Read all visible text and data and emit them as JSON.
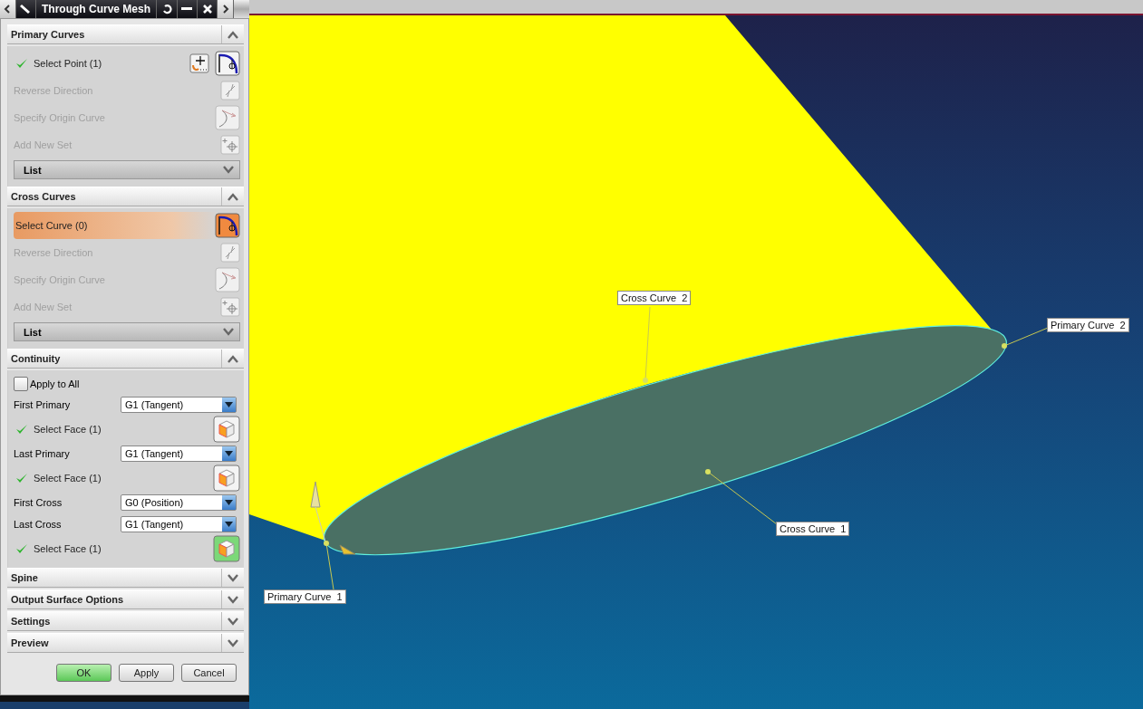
{
  "dialog": {
    "title": "Through Curve Mesh",
    "sections": [
      {
        "title": "Primary Curves",
        "expanded": true,
        "rows": [
          {
            "kind": "curve-select",
            "label": "Select Point (1)",
            "done": true,
            "active": false
          },
          {
            "kind": "reverse",
            "label": "Reverse Direction",
            "disabled": true
          },
          {
            "kind": "origin",
            "label": "Specify Origin Curve",
            "disabled": true
          },
          {
            "kind": "add-set",
            "label": "Add New Set",
            "disabled": true
          },
          {
            "kind": "list",
            "label": "List"
          }
        ]
      },
      {
        "title": "Cross Curves",
        "expanded": true,
        "rows": [
          {
            "kind": "curve-select",
            "label": "Select Curve (0)",
            "done": false,
            "active": true
          },
          {
            "kind": "reverse",
            "label": "Reverse Direction",
            "disabled": true
          },
          {
            "kind": "origin",
            "label": "Specify Origin Curve",
            "disabled": true
          },
          {
            "kind": "add-set",
            "label": "Add New Set",
            "disabled": true
          },
          {
            "kind": "list",
            "label": "List"
          }
        ]
      },
      {
        "title": "Continuity",
        "expanded": true,
        "rows": [
          {
            "kind": "checkbox",
            "label": "Apply to All",
            "checked": false
          },
          {
            "kind": "dropdown",
            "label": "First Primary",
            "value": "G1 (Tangent)"
          },
          {
            "kind": "face-select",
            "label": "Select Face (1)",
            "done": true,
            "active": false
          },
          {
            "kind": "dropdown",
            "label": "Last Primary",
            "value": "G1 (Tangent)"
          },
          {
            "kind": "face-select",
            "label": "Select Face (1)",
            "done": true,
            "active": false
          },
          {
            "kind": "dropdown",
            "label": "First Cross",
            "value": "G0 (Position)"
          },
          {
            "kind": "dropdown",
            "label": "Last Cross",
            "value": "G1 (Tangent)"
          },
          {
            "kind": "face-select",
            "label": "Select Face (1)",
            "done": true,
            "active": true
          }
        ]
      },
      {
        "title": "Spine",
        "expanded": false
      },
      {
        "title": "Output Surface Options",
        "expanded": false
      },
      {
        "title": "Settings",
        "expanded": false
      },
      {
        "title": "Preview",
        "expanded": false
      }
    ],
    "buttons": [
      {
        "label": "OK",
        "default": true
      },
      {
        "label": "Apply",
        "default": false
      },
      {
        "label": "Cancel",
        "default": false
      }
    ]
  },
  "viewport": {
    "labels": [
      {
        "text": "Cross Curve  2"
      },
      {
        "text": "Primary Curve  2"
      },
      {
        "text": "Cross Curve  1"
      },
      {
        "text": "Primary Curve  1"
      }
    ]
  }
}
